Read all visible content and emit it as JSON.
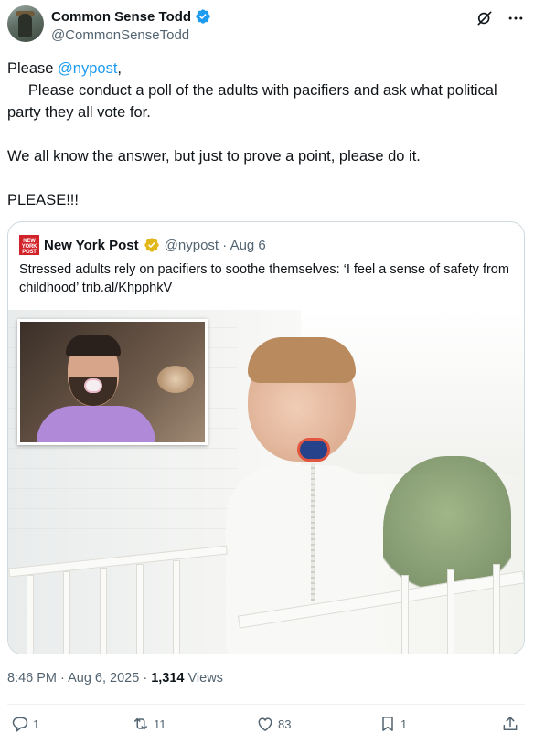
{
  "author": {
    "display_name": "Common Sense Todd",
    "handle": "@CommonSenseTodd"
  },
  "tweet": {
    "line1_prefix": "Please ",
    "line1_mention": "@nypost",
    "line1_suffix": ",",
    "line2": "     Please conduct a poll of the adults with pacifiers and ask what political party they all vote for.",
    "line3": "We all know the answer, but just to prove a point, please do it.",
    "line4": "PLEASE!!!"
  },
  "quote": {
    "logo_text": "NEW YORK POST",
    "name": "New York Post",
    "meta": "@nypost · Aug 6",
    "text": "Stressed adults rely on pacifiers to soothe themselves: ‘I feel a sense of safety from childhood’ trib.al/KhpphkV"
  },
  "meta": {
    "timestamp": "8:46 PM · Aug 6, 2025 · ",
    "views_count": "1,314",
    "views_label": " Views"
  },
  "actions": {
    "replies": "1",
    "reposts": "11",
    "likes": "83",
    "bookmarks": "1"
  },
  "colors": {
    "accent": "#1d9bf0",
    "nypost_red": "#d1232a",
    "gold_badge": "#e2b719"
  },
  "icons": [
    "verified-badge-icon",
    "grok-icon",
    "more-icon",
    "gold-check-icon",
    "reply-icon",
    "repost-icon",
    "like-icon",
    "bookmark-icon",
    "share-icon"
  ]
}
